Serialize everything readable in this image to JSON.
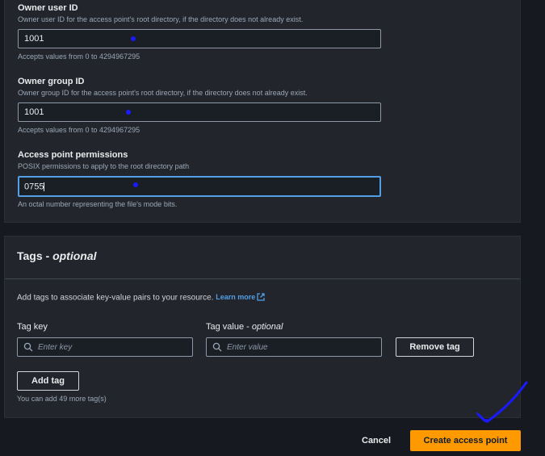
{
  "posix": {
    "owner_user": {
      "label": "Owner user ID",
      "description": "Owner user ID for the access point's root directory, if the directory does not already exist.",
      "value": "1001",
      "hint": "Accepts values from 0 to 4294967295"
    },
    "owner_group": {
      "label": "Owner group ID",
      "description": "Owner group ID for the access point's root directory, if the directory does not already exist.",
      "value": "1001",
      "hint": "Accepts values from 0 to 4294967295"
    },
    "permissions": {
      "label": "Access point permissions",
      "description": "POSIX permissions to apply to the root directory path",
      "value": "0755",
      "hint": "An octal number representing the file's mode bits."
    }
  },
  "tags": {
    "title": "Tags - ",
    "title_optional": "optional",
    "intro": "Add tags to associate key-value pairs to your resource.",
    "learn_more": "Learn more",
    "key_label": "Tag key",
    "value_label": "Tag value - ",
    "value_label_optional": "optional",
    "key_placeholder": "Enter key",
    "value_placeholder": "Enter value",
    "remove_label": "Remove tag",
    "add_label": "Add tag",
    "remaining": "You can add 49 more tag(s)"
  },
  "footer": {
    "cancel_label": "Cancel",
    "create_label": "Create access point"
  },
  "colors": {
    "primary": "#ff9900",
    "link": "#539fe5",
    "annotation": "#1a1aff"
  },
  "icons": [
    "search-icon",
    "external-link-icon",
    "checkmark-annotation"
  ]
}
